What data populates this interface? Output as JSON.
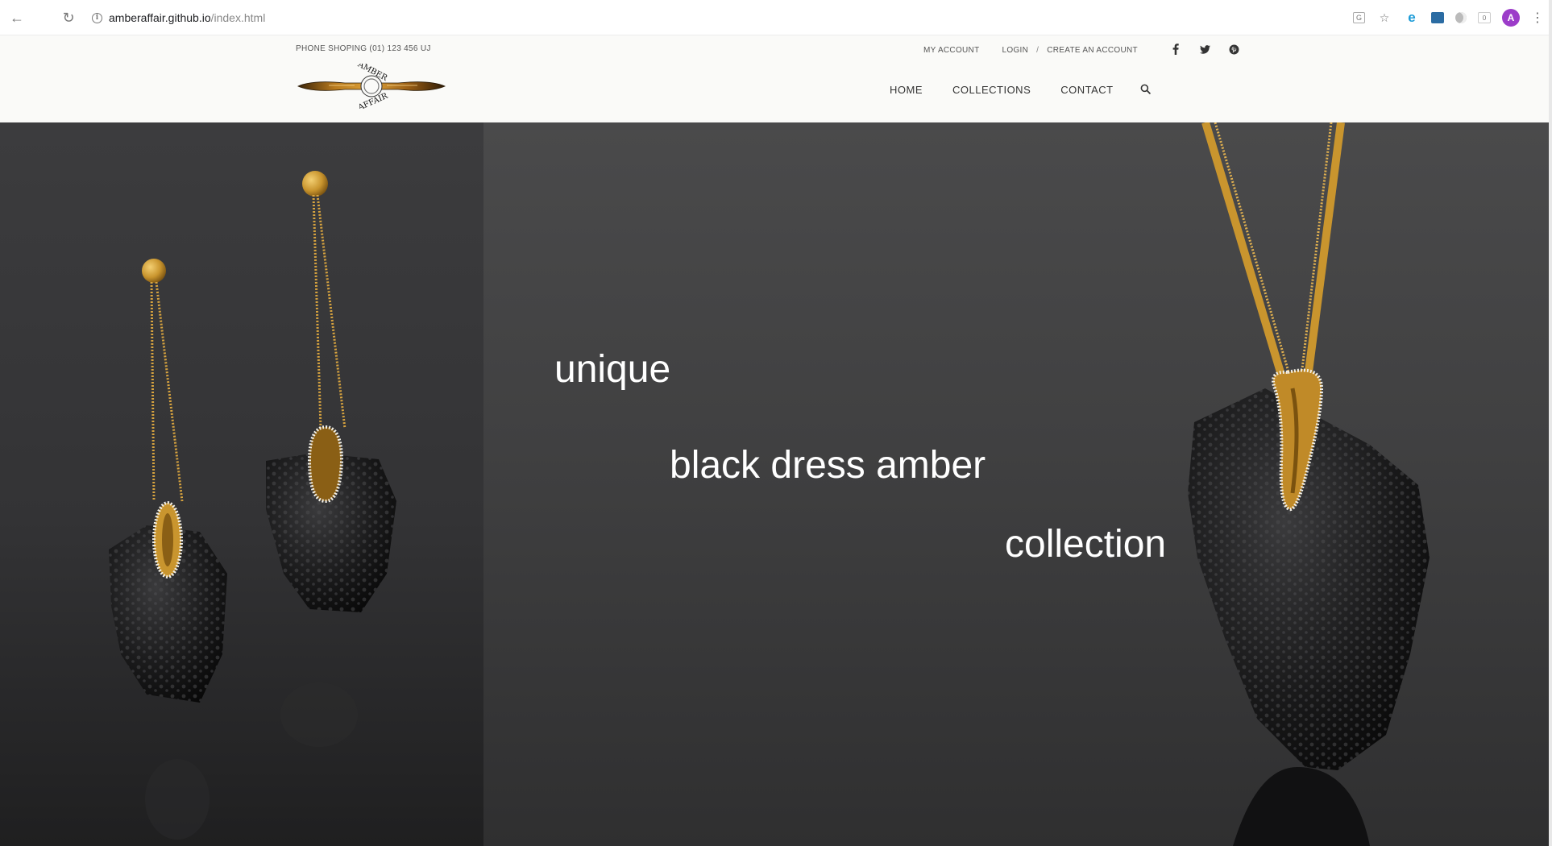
{
  "browser": {
    "url_host": "amberaffair.github.io",
    "url_path": "/index.html",
    "profile_initial": "A",
    "icons": [
      "back-arrow-icon",
      "reload-icon",
      "site-info-icon",
      "translate-icon",
      "bookmark-star-icon",
      "edge-extension-icon",
      "video-extension-icon",
      "dark-mode-extension-icon",
      "extension-badge-icon",
      "more-menu-icon"
    ]
  },
  "header": {
    "phone": "PHONE SHOPING (01) 123 456 UJ",
    "logo_text": "AMBER AFFAIR",
    "top_links": [
      "MY ACCOUNT",
      "LOGIN",
      "CREATE AN ACCOUNT"
    ],
    "link_separator": "/",
    "social_icons": [
      "facebook-icon",
      "twitter-icon",
      "pinterest-icon"
    ],
    "nav": [
      "HOME",
      "COLLECTIONS",
      "CONTACT"
    ],
    "search_icon": "search-icon"
  },
  "hero": {
    "line1": "unique",
    "line2": "black dress amber",
    "line3": "collection",
    "text_color": "#ffffff",
    "background_color": "#3f3f40",
    "accent_gold": "#c9952e"
  }
}
